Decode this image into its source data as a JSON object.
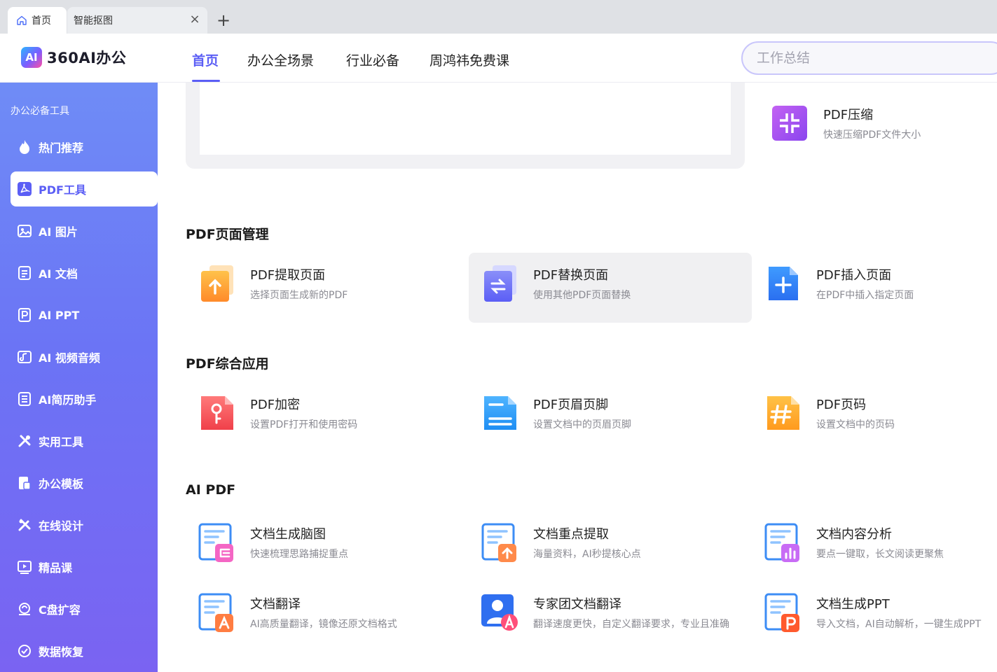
{
  "browser": {
    "tabs": [
      {
        "label": "首页",
        "icon": "home-icon"
      },
      {
        "label": "智能抠图"
      }
    ],
    "close_symbol": "×",
    "new_tab_symbol": "+"
  },
  "header": {
    "logo_mark": "AI",
    "logo_text": "360AI办公",
    "nav": [
      "首页",
      "办公全场景",
      "行业必备",
      "周鸿祎免费课"
    ],
    "active_nav": "首页",
    "search_placeholder": "工作总结"
  },
  "sidebar": {
    "title": "办公必备工具",
    "items": [
      {
        "label": "热门推荐",
        "icon": "flame-icon"
      },
      {
        "label": "PDF工具",
        "icon": "pdf-icon"
      },
      {
        "label": "AI 图片",
        "icon": "image-icon"
      },
      {
        "label": "AI 文档",
        "icon": "document-icon"
      },
      {
        "label": "AI PPT",
        "icon": "ppt-icon"
      },
      {
        "label": "AI 视频音频",
        "icon": "video-audio-icon"
      },
      {
        "label": "AI简历助手",
        "icon": "resume-icon"
      },
      {
        "label": "实用工具",
        "icon": "tools-icon"
      },
      {
        "label": "办公模板",
        "icon": "template-icon"
      },
      {
        "label": "在线设计",
        "icon": "design-icon"
      },
      {
        "label": "精品课",
        "icon": "course-icon"
      },
      {
        "label": "C盘扩容",
        "icon": "disk-icon"
      },
      {
        "label": "数据恢复",
        "icon": "recovery-icon"
      }
    ],
    "active_item": "PDF工具"
  },
  "main": {
    "top_tool": {
      "name": "PDF压缩",
      "desc": "快速压缩PDF文件大小",
      "icon": "compress-icon"
    },
    "sections": [
      {
        "title": "PDF页面管理",
        "tools": [
          {
            "name": "PDF提取页面",
            "desc": "选择页面生成新的PDF",
            "icon": "extract-page-icon"
          },
          {
            "name": "PDF替换页面",
            "desc": "使用其他PDF页面替换",
            "icon": "replace-page-icon"
          },
          {
            "name": "PDF插入页面",
            "desc": "在PDF中插入指定页面",
            "icon": "insert-page-icon"
          }
        ]
      },
      {
        "title": "PDF综合应用",
        "tools": [
          {
            "name": "PDF加密",
            "desc": "设置PDF打开和使用密码",
            "icon": "encrypt-icon"
          },
          {
            "name": "PDF页眉页脚",
            "desc": "设置文档中的页眉页脚",
            "icon": "header-footer-icon"
          },
          {
            "name": "PDF页码",
            "desc": "设置文档中的页码",
            "icon": "page-number-icon"
          }
        ]
      },
      {
        "title": "AI PDF",
        "tools": [
          {
            "name": "文档生成脑图",
            "desc": "快速梳理思路捕捉重点",
            "icon": "mindmap-icon"
          },
          {
            "name": "文档重点提取",
            "desc": "海量资料，AI秒提核心点",
            "icon": "keypoint-icon"
          },
          {
            "name": "文档内容分析",
            "desc": "要点一键取，长文阅读更聚焦",
            "icon": "analysis-icon"
          },
          {
            "name": "文档翻译",
            "desc": "AI高质量翻译，镜像还原文档格式",
            "icon": "translate-icon"
          },
          {
            "name": "专家团文档翻译",
            "desc": "翻译速度更快，自定义翻译要求，专业且准确",
            "icon": "expert-translate-icon"
          },
          {
            "name": "文档生成PPT",
            "desc": "导入文档，AI自动解析，一键生成PPT",
            "icon": "doc-to-ppt-icon"
          }
        ]
      }
    ]
  },
  "colors": {
    "accent": "#5b5ef5",
    "sidebar_top": "#6f8cf6",
    "sidebar_bottom": "#7a63f2"
  }
}
